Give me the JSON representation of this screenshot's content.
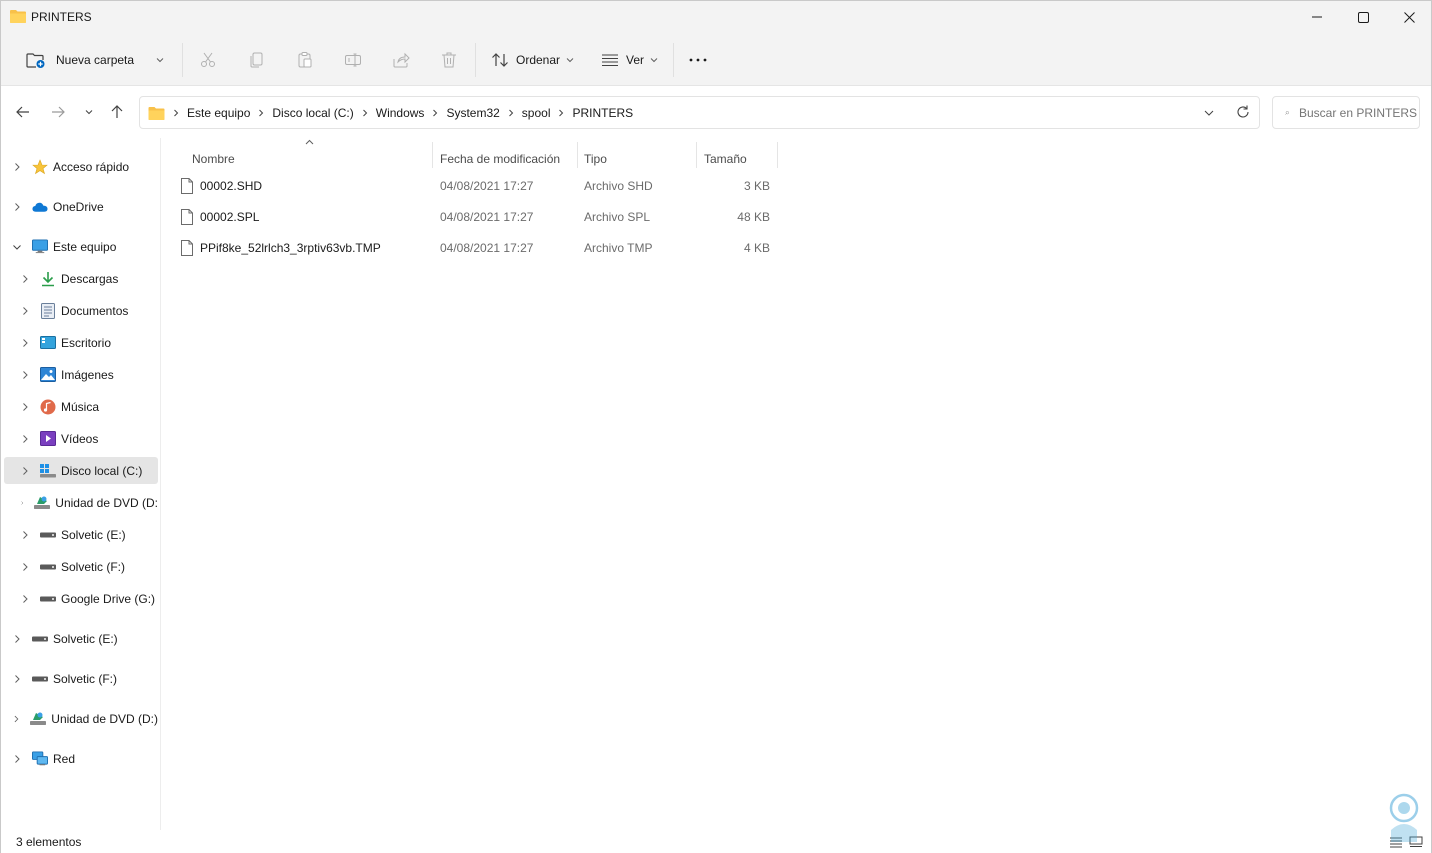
{
  "window": {
    "title": "PRINTERS"
  },
  "toolbar": {
    "new_folder_label": "Nueva carpeta",
    "sort_label": "Ordenar",
    "view_label": "Ver",
    "icons": [
      "cut-icon",
      "copy-icon",
      "paste-icon",
      "rename-icon",
      "share-icon",
      "delete-icon"
    ]
  },
  "address": {
    "breadcrumbs": [
      "Este equipo",
      "Disco local (C:)",
      "Windows",
      "System32",
      "spool",
      "PRINTERS"
    ]
  },
  "search": {
    "placeholder": "Buscar en PRINTERS"
  },
  "sidebar": {
    "items": [
      {
        "label": "Acceso rápido",
        "icon": "star-icon"
      },
      {
        "label": "OneDrive",
        "icon": "cloud-icon"
      },
      {
        "label": "Este equipo",
        "icon": "monitor-icon"
      },
      {
        "label": "Descargas",
        "icon": "download-icon"
      },
      {
        "label": "Documentos",
        "icon": "document-icon"
      },
      {
        "label": "Escritorio",
        "icon": "desktop-icon"
      },
      {
        "label": "Imágenes",
        "icon": "pictures-icon"
      },
      {
        "label": "Música",
        "icon": "music-icon"
      },
      {
        "label": "Vídeos",
        "icon": "video-icon"
      },
      {
        "label": "Disco local (C:)",
        "icon": "drive-icon"
      },
      {
        "label": "Unidad de DVD (D:",
        "icon": "dvd-icon"
      },
      {
        "label": "Solvetic (E:)",
        "icon": "usb-drive-icon"
      },
      {
        "label": "Solvetic (F:)",
        "icon": "usb-drive-icon"
      },
      {
        "label": "Google Drive (G:)",
        "icon": "usb-drive-icon"
      },
      {
        "label": "Solvetic (E:)",
        "icon": "usb-drive-icon"
      },
      {
        "label": "Solvetic (F:)",
        "icon": "usb-drive-icon"
      },
      {
        "label": "Unidad de DVD (D:)",
        "icon": "dvd-icon"
      },
      {
        "label": "Red",
        "icon": "network-icon"
      }
    ]
  },
  "columns": {
    "name": "Nombre",
    "date": "Fecha de modificación",
    "type": "Tipo",
    "size": "Tamaño"
  },
  "files": [
    {
      "name": "00002.SHD",
      "date": "04/08/2021 17:27",
      "type": "Archivo SHD",
      "size": "3 KB"
    },
    {
      "name": "00002.SPL",
      "date": "04/08/2021 17:27",
      "type": "Archivo SPL",
      "size": "48 KB"
    },
    {
      "name": "PPif8ke_52lrlch3_3rptiv63vb.TMP",
      "date": "04/08/2021 17:27",
      "type": "Archivo TMP",
      "size": "4 KB"
    }
  ],
  "status": {
    "count": "3 elementos"
  },
  "colors": {
    "accent": "#0067c0",
    "folder": "#f8c14a",
    "selected": "#e5e5e5"
  }
}
